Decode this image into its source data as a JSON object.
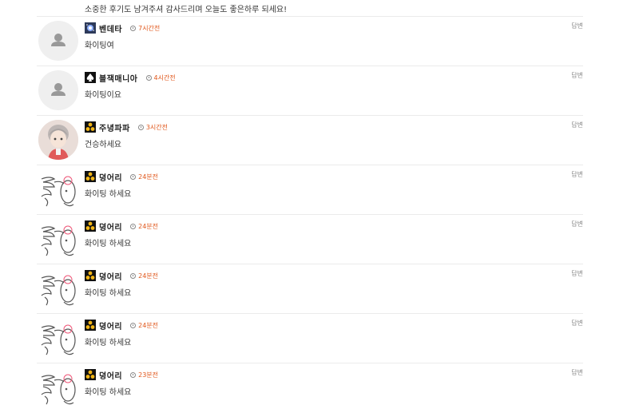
{
  "top_comment_text": "소중한 후기도 남겨주셔 감사드리며 오늘도 좋은하루 되세요!",
  "reply_label": "답변",
  "colors": {
    "time_accent": "#e0561a",
    "separator": "#ebebeb"
  },
  "comments": [
    {
      "nickname": "벤데타",
      "time": "7시간전",
      "text": "화이팅여",
      "avatar": "default-avatar-icon",
      "badge": "galaxy-badge-icon"
    },
    {
      "nickname": "블잭매니아",
      "time": "4시간전",
      "text": "화이팅이요",
      "avatar": "default-avatar-icon",
      "badge": "spade-badge-icon"
    },
    {
      "nickname": "주녕파파",
      "time": "3시간전",
      "text": "건승하세요",
      "avatar": "photo-avatar",
      "badge": "gold-coins-badge-icon"
    },
    {
      "nickname": "뎡어리",
      "time": "24분전",
      "text": "화이팅 하세요",
      "avatar": "sketch-avatar",
      "badge": "gold-coins-badge-icon"
    },
    {
      "nickname": "뎡어리",
      "time": "24분전",
      "text": "화이팅 하세요",
      "avatar": "sketch-avatar",
      "badge": "gold-coins-badge-icon"
    },
    {
      "nickname": "뎡어리",
      "time": "24분전",
      "text": "화이팅 하세요",
      "avatar": "sketch-avatar",
      "badge": "gold-coins-badge-icon"
    },
    {
      "nickname": "뎡어리",
      "time": "24분전",
      "text": "화이팅 하세요",
      "avatar": "sketch-avatar",
      "badge": "gold-coins-badge-icon"
    },
    {
      "nickname": "뎡어리",
      "time": "23분전",
      "text": "화이팅 하세요",
      "avatar": "sketch-avatar",
      "badge": "gold-coins-badge-icon"
    }
  ]
}
